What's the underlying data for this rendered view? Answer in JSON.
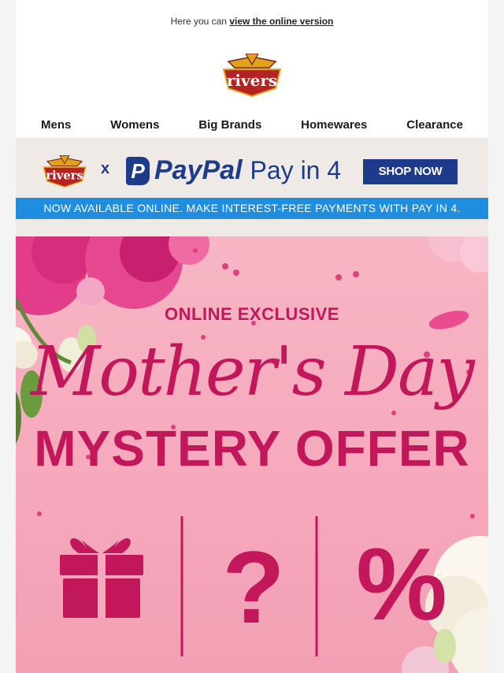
{
  "preheader": {
    "prefix": "Here you can",
    "link": "view the online version"
  },
  "brand": {
    "logo_text": "rivers"
  },
  "nav": {
    "items": [
      "Mens",
      "Womens",
      "Big Brands",
      "Homewares",
      "Clearance"
    ]
  },
  "promo": {
    "x": "x",
    "paypal_mark": "P",
    "paypal": "PayPal",
    "pay_in_4": "Pay in 4",
    "button": "SHOP NOW",
    "banner": "NOW AVAILABLE ONLINE. MAKE INTEREST-FREE PAYMENTS WITH PAY IN 4."
  },
  "hero": {
    "kicker": "ONLINE EXCLUSIVE",
    "script": "Mother's Day",
    "headline": "MYSTERY OFFER",
    "symbol_question": "?",
    "symbol_percent": "%"
  },
  "colors": {
    "accent": "#c2185b",
    "paypal_blue": "#1e3a8a",
    "banner_blue": "#1f8ee0",
    "hero_pink": "#f6a9bc"
  }
}
